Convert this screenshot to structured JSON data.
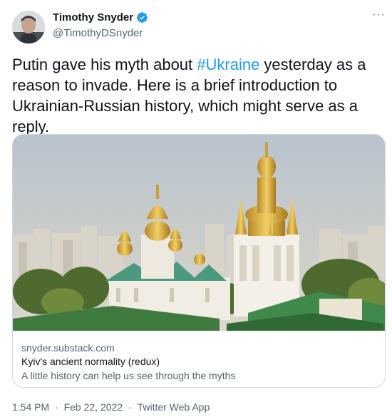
{
  "author": {
    "display_name": "Timothy Snyder",
    "handle": "@TimothyDSnyder",
    "verified": true,
    "avatar_icon": "profile-photo"
  },
  "more_icon": "ellipsis-icon",
  "tweet": {
    "text_before": "Putin gave his myth about ",
    "hashtag": "#Ukraine",
    "text_after": " yesterday as a reason to invade. Here is a brief introduction to Ukrainian-Russian history, which might serve as a reply."
  },
  "link_card": {
    "domain": "snyder.substack.com",
    "title": "Kyiv's ancient normality (redux)",
    "description": "A little history can help us see through the myths",
    "image_alt": "golden-domed-church-photo"
  },
  "meta": {
    "time": "1:54 PM",
    "separator1": "·",
    "date": "Feb 22, 2022",
    "separator2": "·",
    "source": "Twitter Web App"
  },
  "colors": {
    "accent": "#1d9bf0",
    "text": "#0f1419",
    "secondary": "#536471",
    "border": "#cfd9de"
  }
}
